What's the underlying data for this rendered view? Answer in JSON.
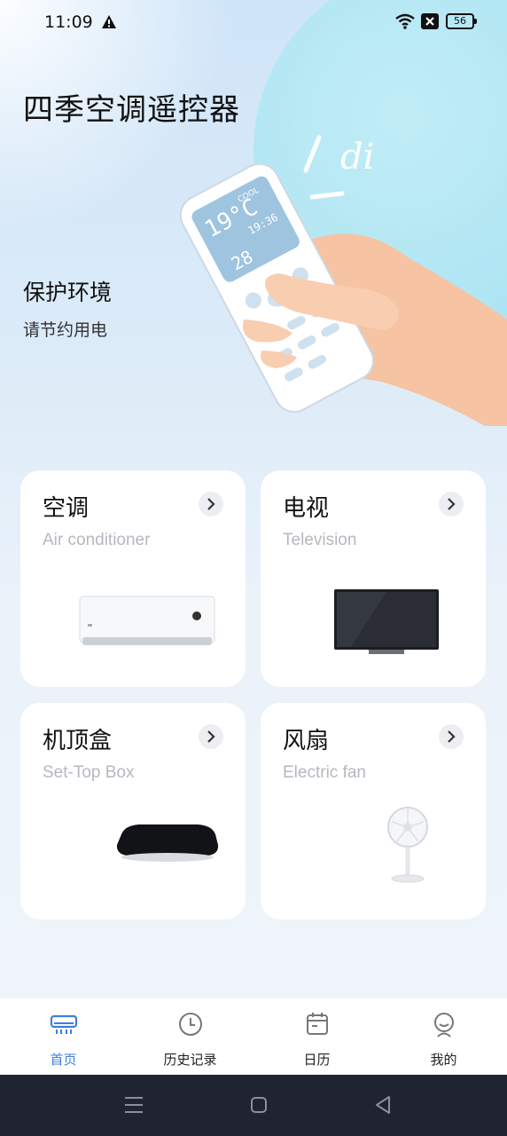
{
  "status_bar": {
    "time": "11:09",
    "battery": "56"
  },
  "header": {
    "app_title": "四季空调遥控器",
    "slogan_title": "保护环境",
    "slogan_sub": "请节约用电"
  },
  "hero": {
    "sound_text": "di",
    "display_temp": "19°C",
    "display_mode": "COOL",
    "display_time": "19:36",
    "display_num": "28"
  },
  "devices": [
    {
      "title": "空调",
      "subtitle": "Air conditioner"
    },
    {
      "title": "电视",
      "subtitle": "Television"
    },
    {
      "title": "机顶盒",
      "subtitle": "Set-Top Box"
    },
    {
      "title": "风扇",
      "subtitle": "Electric fan"
    }
  ],
  "nav": [
    {
      "label": "首页",
      "icon": "air-conditioner-icon",
      "active": true
    },
    {
      "label": "历史记录",
      "icon": "clock-icon",
      "active": false
    },
    {
      "label": "日历",
      "icon": "calendar-icon",
      "active": false
    },
    {
      "label": "我的",
      "icon": "profile-icon",
      "active": false
    }
  ],
  "colors": {
    "accent": "#3d7ee0",
    "card_subtitle": "#b5b8bf",
    "system_bar": "#1f2430"
  }
}
